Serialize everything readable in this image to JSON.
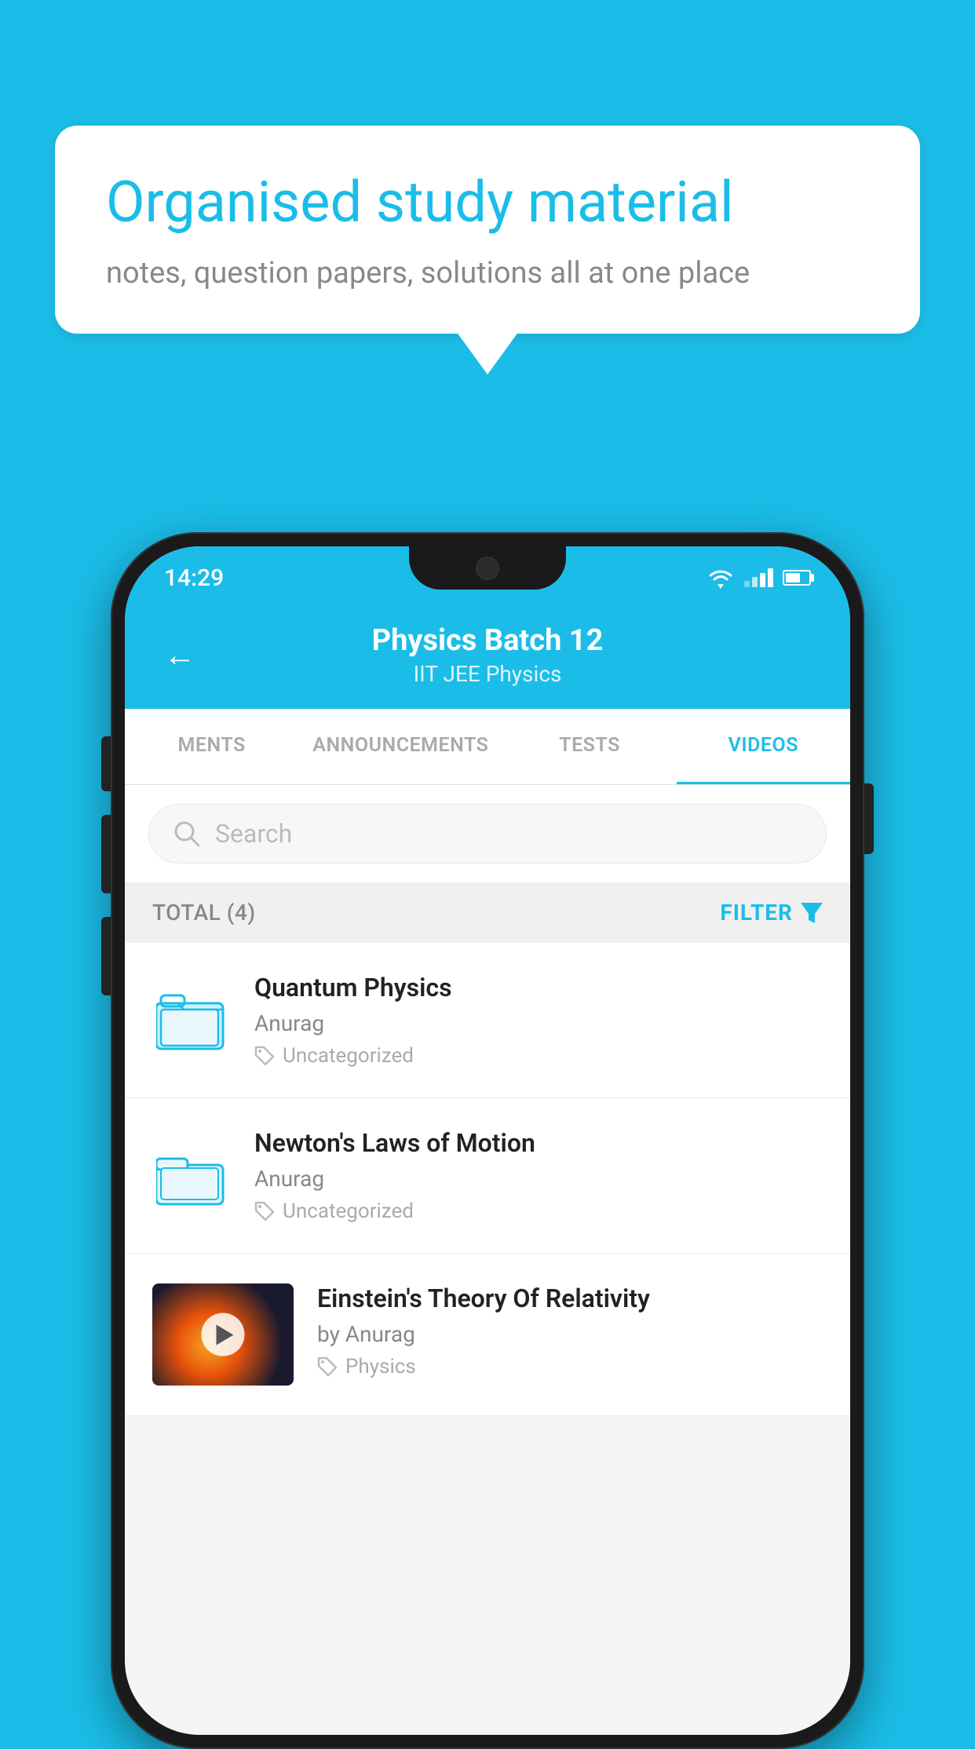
{
  "background": {
    "color": "#1bbde8"
  },
  "speech_bubble": {
    "title": "Organised study material",
    "subtitle": "notes, question papers, solutions all at one place"
  },
  "status_bar": {
    "time": "14:29"
  },
  "header": {
    "title": "Physics Batch 12",
    "subtitle": "IIT JEE   Physics",
    "back_label": "←"
  },
  "tabs": [
    {
      "label": "MENTS",
      "active": false
    },
    {
      "label": "ANNOUNCEMENTS",
      "active": false
    },
    {
      "label": "TESTS",
      "active": false
    },
    {
      "label": "VIDEOS",
      "active": true
    }
  ],
  "search": {
    "placeholder": "Search"
  },
  "filter_bar": {
    "total_label": "TOTAL (4)",
    "filter_label": "FILTER"
  },
  "videos": [
    {
      "title": "Quantum Physics",
      "author": "Anurag",
      "tag": "Uncategorized",
      "has_thumbnail": false
    },
    {
      "title": "Newton's Laws of Motion",
      "author": "Anurag",
      "tag": "Uncategorized",
      "has_thumbnail": false
    },
    {
      "title": "Einstein's Theory Of Relativity",
      "author": "by Anurag",
      "tag": "Physics",
      "has_thumbnail": true
    }
  ]
}
